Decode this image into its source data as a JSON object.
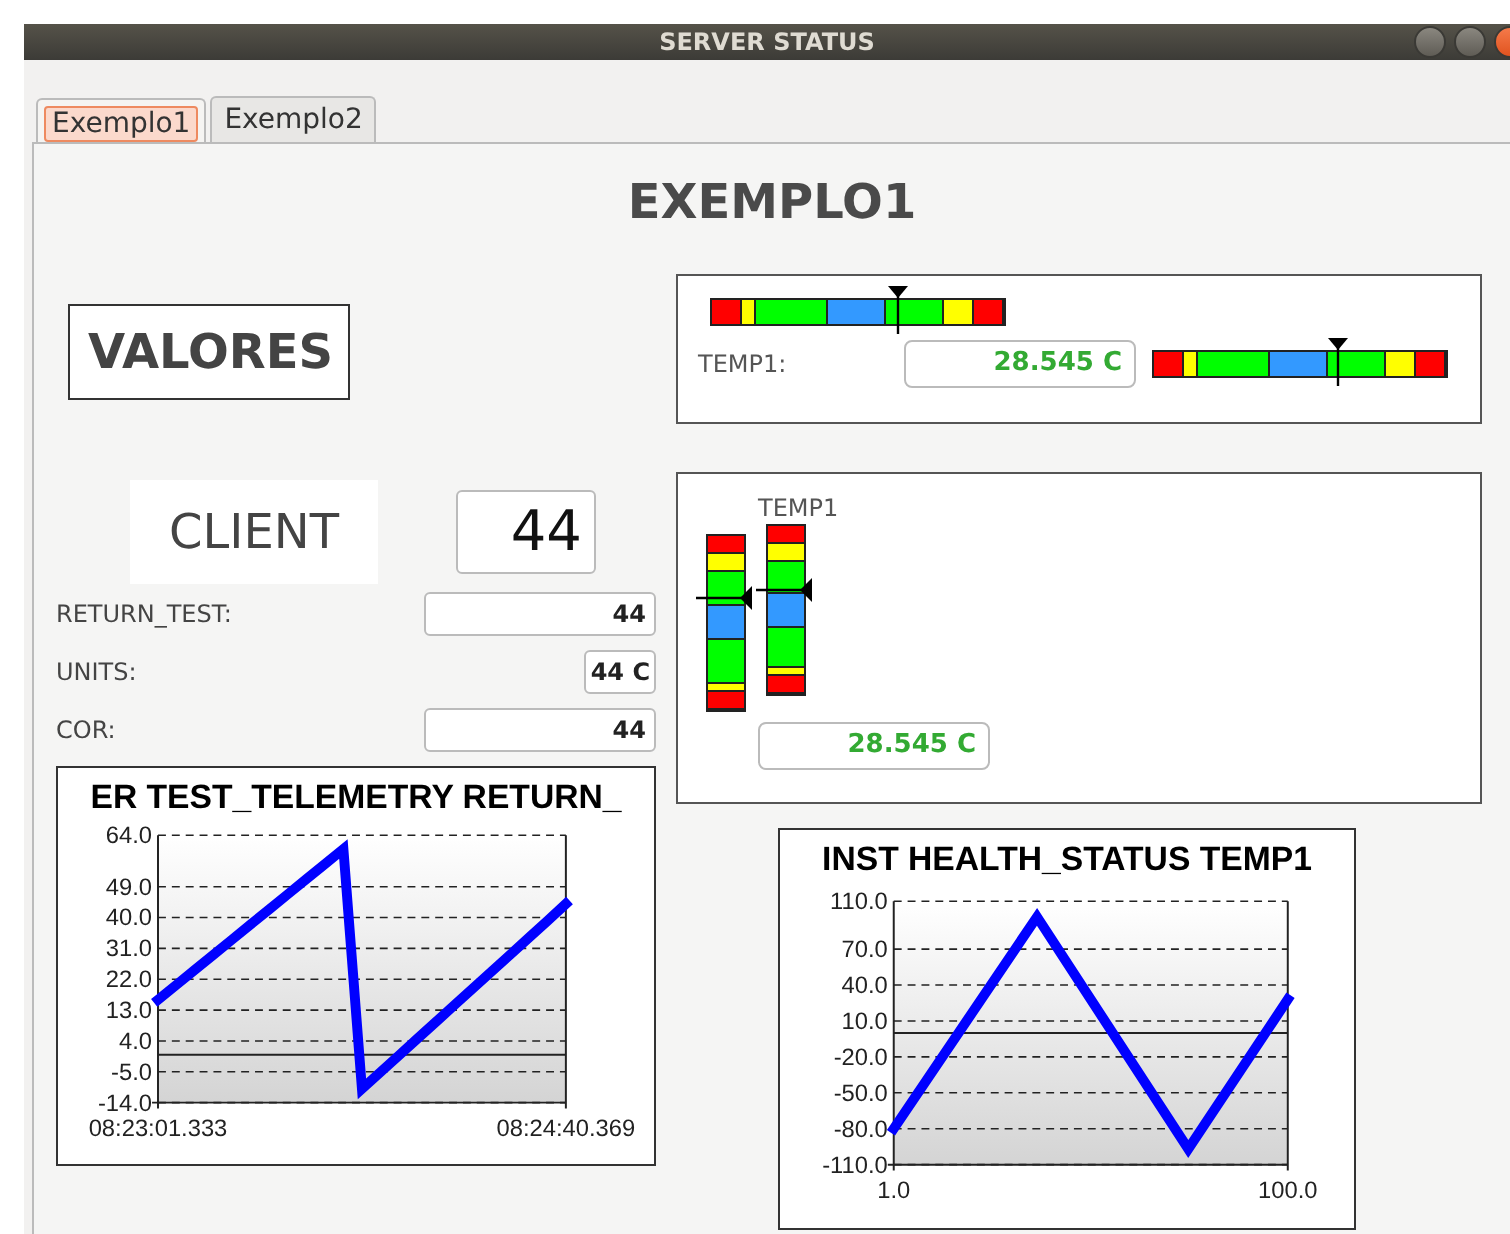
{
  "window": {
    "title": "SERVER STATUS"
  },
  "tabs": [
    {
      "label": "Exemplo1",
      "selected": true
    },
    {
      "label": "Exemplo2",
      "selected": false
    }
  ],
  "heading": "EXEMPLO1",
  "section_label": "VALORES",
  "client": {
    "label": "CLIENT",
    "value": "44"
  },
  "fields": [
    {
      "label": "RETURN_TEST:",
      "value": "44",
      "kind": "wide"
    },
    {
      "label": "UNITS:",
      "value": "44 C",
      "kind": "narrow"
    },
    {
      "label": "COR:",
      "value": "44",
      "kind": "wide"
    }
  ],
  "limits_panel": {
    "top_bar": {
      "level": 0.64
    },
    "label": "TEMP1:",
    "value": "28.545 C",
    "side_bar": {
      "level": 0.63
    }
  },
  "vertical_panel": {
    "label": "TEMP1",
    "bars": [
      {
        "level": 0.64
      },
      {
        "level": 0.62
      }
    ],
    "value": "28.545 C"
  },
  "charts": [
    {
      "chart_data": {
        "type": "line",
        "title": "ER TEST_TELEMETRY RETURN_",
        "grid": true,
        "categories": [
          "08:23:01.333",
          null,
          null,
          null,
          null,
          null,
          null,
          null,
          null,
          null,
          null,
          null,
          null,
          null,
          null,
          null,
          null,
          null,
          null,
          null,
          null,
          null,
          "08:24:40.369"
        ],
        "ylim": [
          -14,
          64
        ],
        "yticks": [
          {
            "value": 64,
            "label": "64.0"
          },
          {
            "value": 49,
            "label": "49.0"
          },
          {
            "value": 40,
            "label": "40.0"
          },
          {
            "value": 31,
            "label": "31.0"
          },
          {
            "value": 22,
            "label": "22.0"
          },
          {
            "value": 13,
            "label": "13.0"
          },
          {
            "value": 4,
            "label": "4.0"
          },
          {
            "value": -5,
            "label": "-5.0"
          },
          {
            "value": -14,
            "label": "-14.0"
          }
        ],
        "series": [
          {
            "color": "#0000ff",
            "values": [
              16,
              20.4,
              24.8,
              29.2,
              33.6,
              38,
              42.4,
              46.8,
              51.2,
              55.6,
              60,
              -10,
              -5.1,
              -0.2,
              4.7,
              9.6,
              14.5,
              19.4,
              24.3,
              29.2,
              34.1,
              39,
              44
            ]
          }
        ]
      }
    },
    {
      "chart_data": {
        "type": "line",
        "title": "INST HEALTH_STATUS TEMP1",
        "grid": true,
        "x": [
          1,
          37,
          75,
          100
        ],
        "xlim": [
          1,
          100
        ],
        "xticks": [
          {
            "value": 1,
            "label": "1.0"
          },
          {
            "value": 100,
            "label": "100.0"
          }
        ],
        "ylim": [
          -110,
          110
        ],
        "yticks": [
          {
            "value": 110,
            "label": "110.0"
          },
          {
            "value": 70,
            "label": "70.0"
          },
          {
            "value": 40,
            "label": "40.0"
          },
          {
            "value": 10,
            "label": "10.0"
          },
          {
            "value": -20,
            "label": "-20.0"
          },
          {
            "value": -50,
            "label": "-50.0"
          },
          {
            "value": -80,
            "label": "-80.0"
          },
          {
            "value": -110,
            "label": "-110.0"
          }
        ],
        "series": [
          {
            "color": "#0000ff",
            "values": [
              -80,
              97,
              -97,
              28
            ]
          }
        ]
      }
    }
  ]
}
